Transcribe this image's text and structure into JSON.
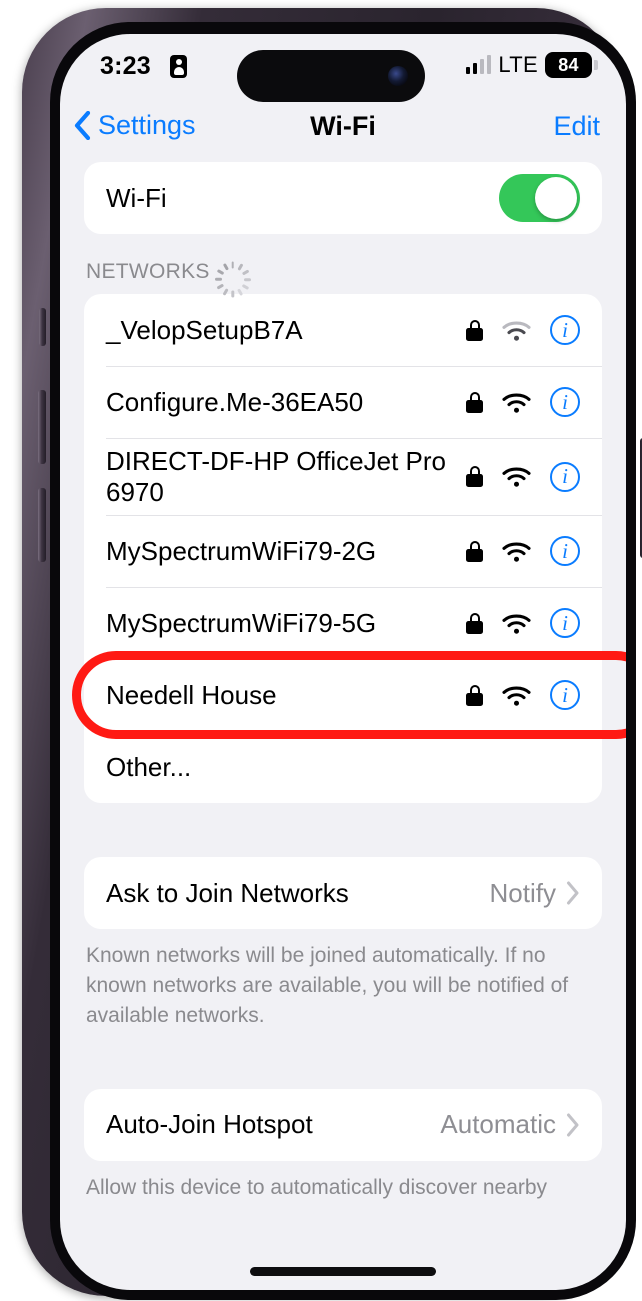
{
  "status_bar": {
    "time": "3:23",
    "focus_icon": "person-card-icon",
    "carrier": "LTE",
    "battery_percent": "84",
    "signal_bars_filled": 2,
    "signal_bars_total": 4
  },
  "nav": {
    "back_label": "Settings",
    "title": "Wi-Fi",
    "edit_label": "Edit"
  },
  "wifi_toggle_row": {
    "label": "Wi-Fi",
    "enabled": true,
    "accent_color": "#34c759"
  },
  "networks_section": {
    "header": "NETWORKS",
    "spinner": "loading-spinner-icon",
    "items": [
      {
        "name": "_VelopSetupB7A",
        "secured": true,
        "signal": "weak",
        "highlighted": false
      },
      {
        "name": "Configure.Me-36EA50",
        "secured": true,
        "signal": "strong",
        "highlighted": false
      },
      {
        "name": "DIRECT-DF-HP OfficeJet Pro 6970",
        "secured": true,
        "signal": "strong",
        "highlighted": false
      },
      {
        "name": "MySpectrumWiFi79-2G",
        "secured": true,
        "signal": "strong",
        "highlighted": false
      },
      {
        "name": "MySpectrumWiFi79-5G",
        "secured": true,
        "signal": "strong",
        "highlighted": false
      },
      {
        "name": "Needell House",
        "secured": true,
        "signal": "strong",
        "highlighted": true
      }
    ],
    "other_label": "Other..."
  },
  "ask_to_join": {
    "label": "Ask to Join Networks",
    "value": "Notify",
    "footnote": "Known networks will be joined automatically. If no known networks are available, you will be notified of available networks."
  },
  "auto_join_hotspot": {
    "label": "Auto-Join Hotspot",
    "value": "Automatic",
    "footnote": "Allow this device to automatically discover nearby"
  },
  "annotation": {
    "target": "Needell House",
    "color": "#ff1a14"
  },
  "theme": {
    "background": "#f1f1f5",
    "card": "#ffffff",
    "link_blue": "#0a7cff",
    "secondary_text": "#8e8e93"
  }
}
